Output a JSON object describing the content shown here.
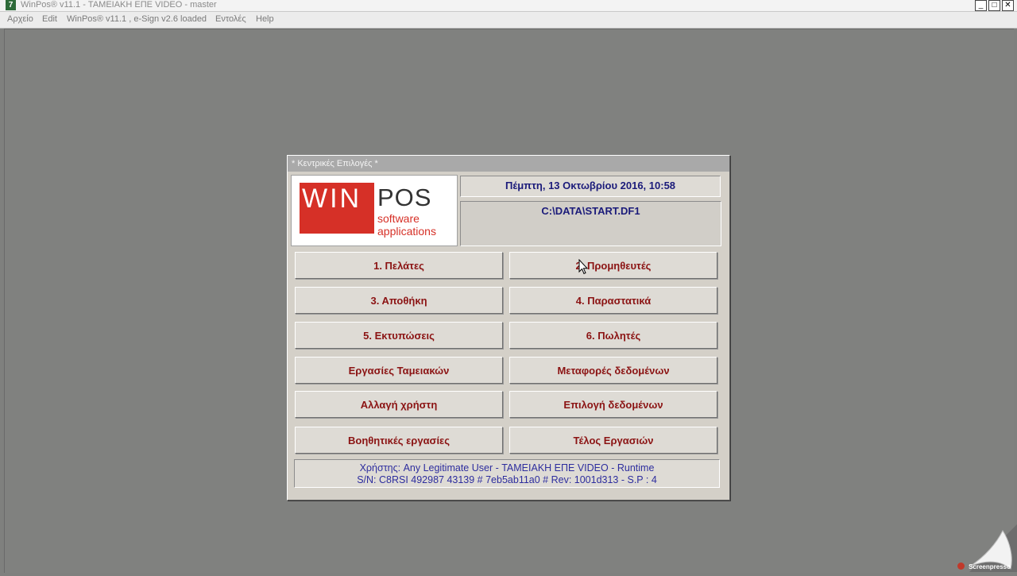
{
  "window": {
    "title": "WinPos® v11.1 - ΤΑΜΕΙΑΚΗ ΕΠΕ VIDEO - master",
    "icon_glyph": "7",
    "controls": [
      "minimize-icon",
      "maximize-icon",
      "close-icon"
    ]
  },
  "menubar": {
    "items": [
      {
        "label": "Αρχείο"
      },
      {
        "label": "Edit"
      },
      {
        "label": "WinPos® v11.1 , e-Sign v2.6 loaded"
      },
      {
        "label": "Εντολές"
      },
      {
        "label": "Help"
      }
    ]
  },
  "dialog": {
    "title": "* Κεντρικές Επιλογές *",
    "logo": {
      "win": "WIN",
      "pos": "POS",
      "line1": "software",
      "line2": "applications"
    },
    "date": "Πέμπτη, 13 Οκτωβρίου 2016, 10:58",
    "path": "C:\\DATA\\START.DF1",
    "buttons": [
      {
        "label": "1. Πελάτες"
      },
      {
        "label": "2. Προμηθευτές"
      },
      {
        "label": "3. Αποθήκη"
      },
      {
        "label": "4. Παραστατικά"
      },
      {
        "label": "5. Εκτυπώσεις"
      },
      {
        "label": "6. Πωλητές"
      },
      {
        "label": "Εργασίες Ταμειακών"
      },
      {
        "label": "Μεταφορές δεδομένων"
      },
      {
        "label": "Αλλαγή χρήστη"
      },
      {
        "label": "Επιλογή δεδομένων"
      },
      {
        "label": "Βοηθητικές εργασίες"
      },
      {
        "label": "Τέλος Εργασιών"
      }
    ],
    "status": {
      "line1": "Χρήστης: Any Legitimate User - ΤΑΜΕΙΑΚΗ ΕΠΕ VIDEO - Runtime",
      "line2": "S/N: C8RSI 492987 43139 # 7eb5ab11a0 # Rev: 1001d313 - S.P : 4"
    }
  },
  "watermark": {
    "text": "Screenpresso"
  },
  "colors": {
    "button_text": "#8b1313",
    "info_text": "#1b1b7a",
    "desktop": "#80817f"
  }
}
